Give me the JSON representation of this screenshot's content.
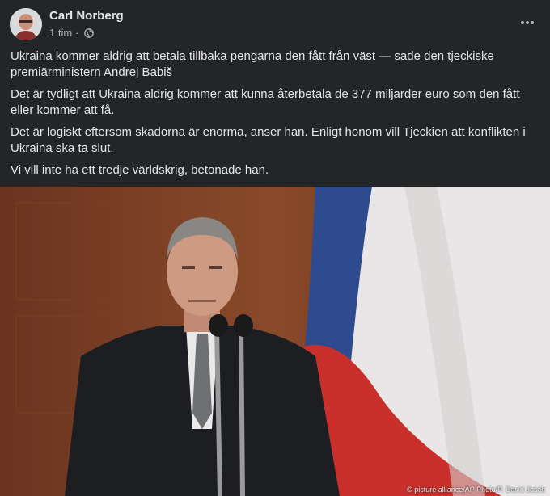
{
  "post": {
    "author": "Carl Norberg",
    "time": "1 tim",
    "separator": "·",
    "privacy_icon": "globe-icon",
    "more_icon": "more-dots-icon",
    "paragraphs": [
      "Ukraina kommer aldrig att betala tillbaka pengarna den fått från väst — sade den tjeckiske premiärministern Andrej Babiš",
      "Det är tydligt att Ukraina aldrig kommer att kunna återbetala de 377 miljarder euro som den fått eller kommer att få.",
      "Det är logiskt eftersom skadorna är enorma, anser han. Enligt honom vill Tjeckien att konflikten i Ukraina ska ta slut.",
      "Vi vill inte ha ett tredje världskrig, betonade han."
    ],
    "photo_credit": "© picture alliance/AP Photo/P. David Josek"
  },
  "colors": {
    "background": "#242526",
    "text": "#e4e6eb",
    "secondary_text": "#b0b3b8",
    "flag_blue": "#2f4b8f",
    "flag_red": "#c9302c",
    "flag_white": "#e8e6e6"
  }
}
